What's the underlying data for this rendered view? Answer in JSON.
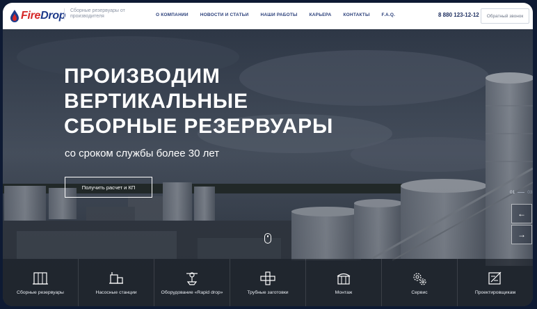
{
  "header": {
    "brand_part1": "Fire",
    "brand_part2": "Drop",
    "tagline": "Сборные резервуары от производителя",
    "nav": [
      "О КОМПАНИИ",
      "НОВОСТИ И СТАТЬИ",
      "НАШИ РАБОТЫ",
      "КАРЬЕРА",
      "КОНТАКТЫ",
      "F.A.Q."
    ],
    "phone": "8 880 123-12-12",
    "callback_label": "Обратный звонок"
  },
  "hero": {
    "title_lines": [
      "ПРОИЗВОДИМ",
      "ВЕРТИКАЛЬНЫЕ",
      "СБОРНЫЕ РЕЗЕРВУАРЫ"
    ],
    "subtitle": "со сроком службы более 30 лет",
    "cta_label": "Получить расчет и КП",
    "slide_current": "01",
    "slide_total": "03"
  },
  "services": [
    {
      "label": "Сборные резервуары",
      "icon": "tank-icon"
    },
    {
      "label": "Насосные станции",
      "icon": "pump-station-icon"
    },
    {
      "label": "Оборудование «Rapid drop»",
      "icon": "equipment-icon"
    },
    {
      "label": "Трубные заготовки",
      "icon": "pipe-icon"
    },
    {
      "label": "Монтаж",
      "icon": "installation-icon"
    },
    {
      "label": "Сервис",
      "icon": "gears-icon"
    },
    {
      "label": "Проектировщикам",
      "icon": "blueprint-icon"
    }
  ],
  "colors": {
    "brand_blue": "#1e3a8a",
    "brand_red": "#d62828",
    "nav_text": "#2a3f7a"
  }
}
